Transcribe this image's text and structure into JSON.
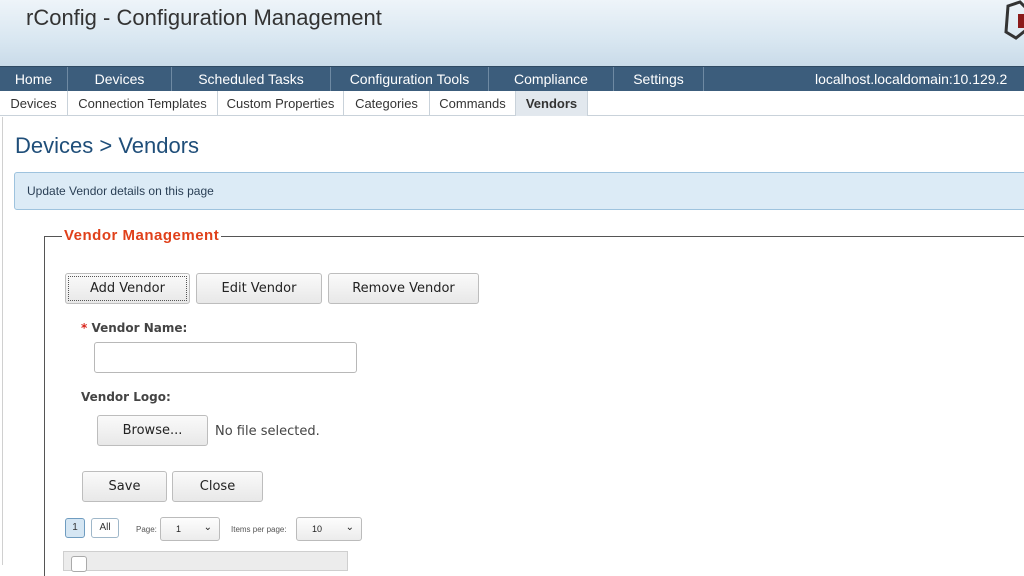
{
  "app": {
    "title": "rConfig - Configuration Management"
  },
  "main_nav": {
    "items": [
      "Home",
      "Devices",
      "Scheduled Tasks",
      "Configuration Tools",
      "Compliance",
      "Settings"
    ],
    "host": "localhost.localdomain:10.129.2"
  },
  "sub_nav": {
    "items": [
      "Devices",
      "Connection Templates",
      "Custom Properties",
      "Categories",
      "Commands",
      "Vendors"
    ],
    "active": "Vendors"
  },
  "page": {
    "title": "Devices > Vendors",
    "info": "Update Vendor details on this page"
  },
  "vendor_mgmt": {
    "legend": "Vendor Management",
    "add_label": "Add Vendor",
    "edit_label": "Edit Vendor",
    "remove_label": "Remove Vendor",
    "required_marker": "*",
    "name_label": "Vendor Name:",
    "name_value": "",
    "logo_label": "Vendor Logo:",
    "browse_label": "Browse...",
    "no_file_text": "No file selected.",
    "save_label": "Save",
    "close_label": "Close"
  },
  "pager": {
    "page_button": "1",
    "all_button": "All",
    "page_label": "Page:",
    "page_value": "1",
    "per_page_label": "Items per page:",
    "per_page_value": "10"
  },
  "colors": {
    "nav_bg": "#3c5d7c",
    "accent": "#e0401a",
    "title": "#1f4e79"
  }
}
